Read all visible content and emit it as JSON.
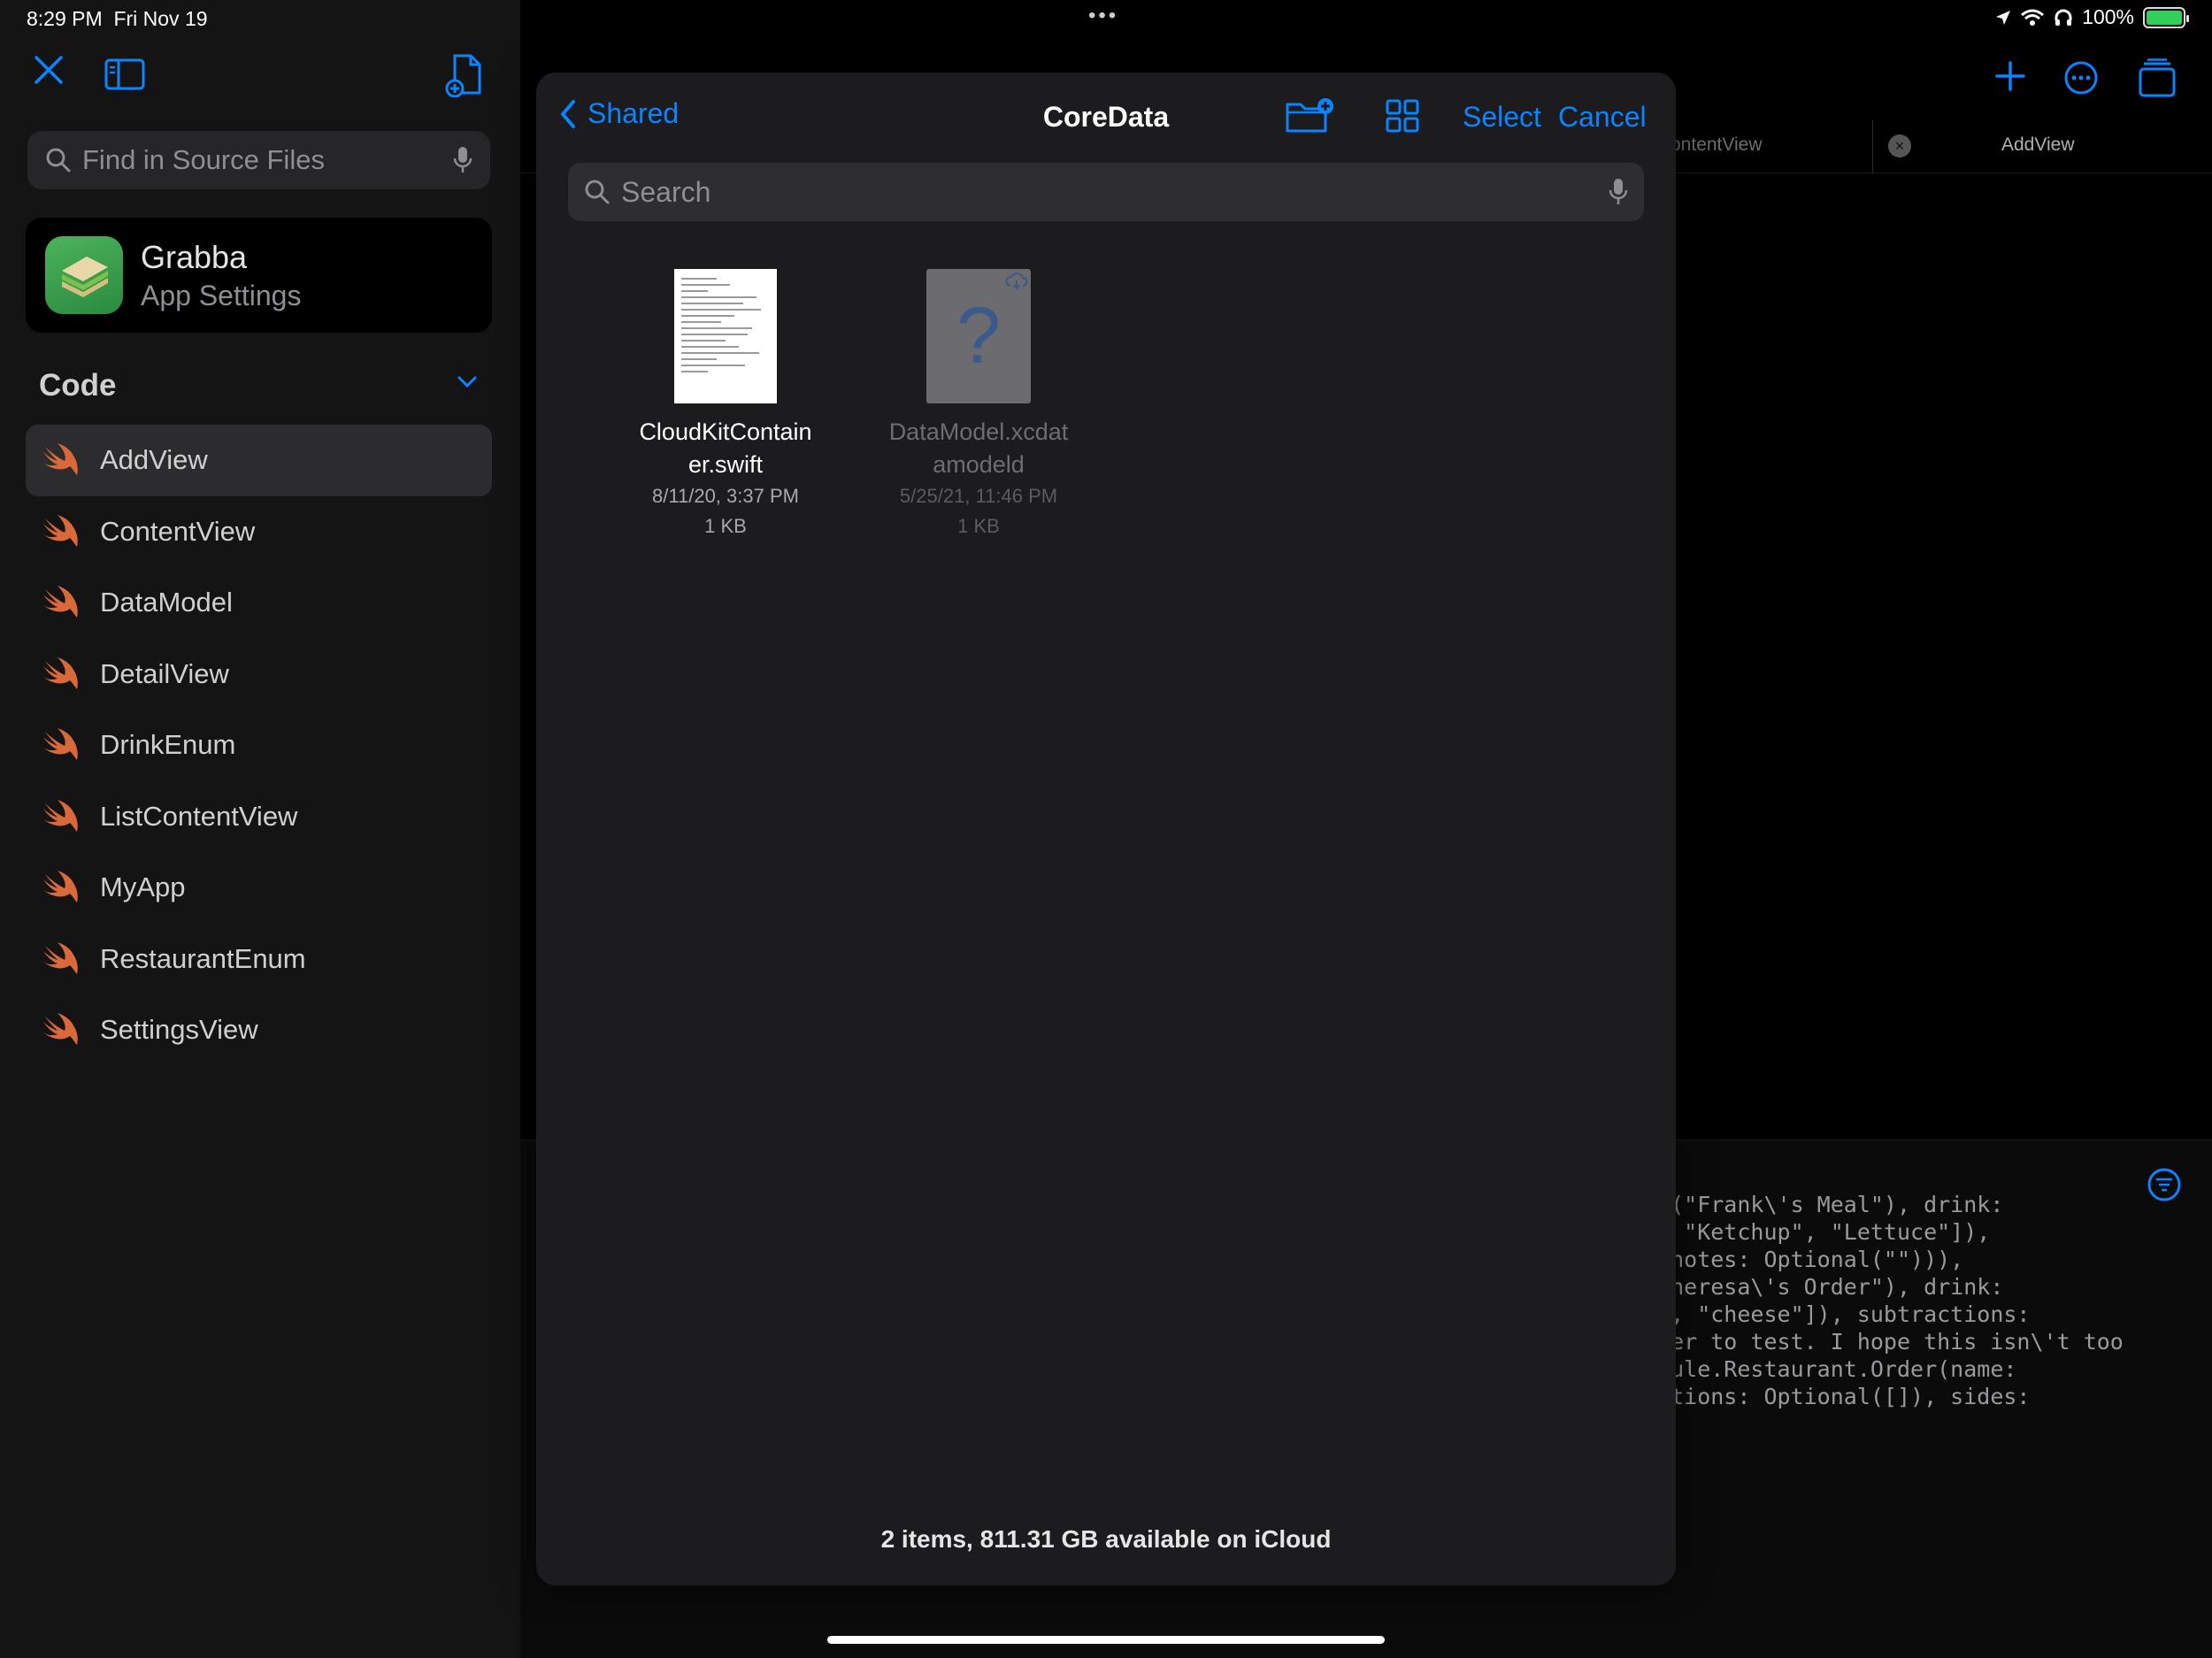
{
  "status": {
    "time": "8:29 PM",
    "date": "Fri Nov 19",
    "battery": "100%"
  },
  "sidebar": {
    "search_placeholder": "Find in Source Files",
    "app": {
      "name": "Grabba",
      "subtitle": "App Settings"
    },
    "section": "Code",
    "files": [
      {
        "label": "AddView",
        "selected": true
      },
      {
        "label": "ContentView"
      },
      {
        "label": "DataModel"
      },
      {
        "label": "DetailView"
      },
      {
        "label": "DrinkEnum"
      },
      {
        "label": "ListContentView"
      },
      {
        "label": "MyApp"
      },
      {
        "label": "RestaurantEnum"
      },
      {
        "label": "SettingsView"
      }
    ]
  },
  "editor": {
    "tab1": "ontentView",
    "tab2": "AddView",
    "console": [
      "al(\"Frank\\'s Meal\"), drink:",
      "\", \"Ketchup\", \"Lettuce\"]),",
      ", notes: Optional(\"\"))),",
      "\"Theresa\\'s Order\"), drink:",
      "o\", \"cheese\"]), subtractions:",
      "rder to test. I hope this isn\\'t too",
      "odule.Restaurant.Order(name:",
      "actions: Optional([]), sides:"
    ]
  },
  "picker": {
    "back_label": "Shared",
    "title": "CoreData",
    "select_label": "Select",
    "cancel_label": "Cancel",
    "search_placeholder": "Search",
    "files": [
      {
        "name_line1": "CloudKitContain",
        "name_line2": "er.swift",
        "date": "8/11/20, 3:37 PM",
        "size": "1 KB"
      },
      {
        "name_line1": "DataModel.xcdat",
        "name_line2": "amodeld",
        "date": "5/25/21, 11:46 PM",
        "size": "1 KB"
      }
    ],
    "footer": "2 items, 811.31 GB available on iCloud"
  },
  "colors": {
    "accent": "#0a84ff",
    "swift_icon": "#d9683a"
  }
}
